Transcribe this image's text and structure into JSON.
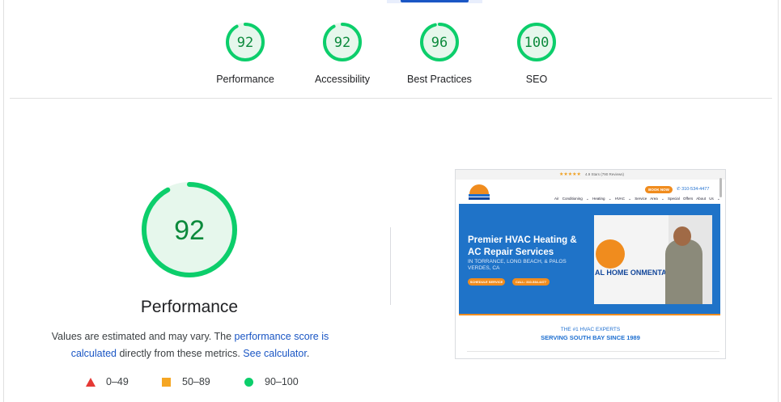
{
  "gauges": [
    {
      "score": "92",
      "value": 92,
      "label": "Performance"
    },
    {
      "score": "92",
      "value": 92,
      "label": "Accessibility"
    },
    {
      "score": "96",
      "value": 96,
      "label": "Best Practices"
    },
    {
      "score": "100",
      "value": 100,
      "label": "SEO"
    }
  ],
  "main": {
    "score": "92",
    "value": 92,
    "title": "Performance",
    "desc_prefix": "Values are estimated and may vary. The ",
    "desc_link1": "performance score is calculated",
    "desc_middle": " directly from these metrics. ",
    "desc_link2": "See calculator",
    "desc_suffix": "."
  },
  "legend": {
    "fail": "0–49",
    "average": "50–89",
    "pass": "90–100"
  },
  "colors": {
    "pass": "#0cce6b",
    "pass_text": "#0c8a3c",
    "average": "#f5a623",
    "fail": "#e53935",
    "link": "#1a56c4"
  },
  "screenshot": {
    "stars": "★★★★★",
    "rating_text": "4.9 Stars (790 Reviews)",
    "logo_text": "TOTAL HOME ENVIRONMENTAL",
    "book_button": "BOOK NOW",
    "phone": "310-534-4477",
    "nav": "Air Conditioning ⌄ Heating ⌄ HVAC ⌄ Service Area ⌄ Special Offers About Us ⌄",
    "hero_title": "Premier HVAC Heating & AC Repair Services",
    "hero_sub": "IN TORRANCE, LONG BEACH, & PALOS VERDES, CA",
    "btn_schedule": "SCHEDULE SERVICE",
    "btn_call": "CALL: 310-534-4477",
    "van_text": "AL HOME ONMENTAL",
    "tagline1": "THE #1 HVAC EXPERTS",
    "tagline2": "SERVING SOUTH BAY SINCE 1989"
  }
}
